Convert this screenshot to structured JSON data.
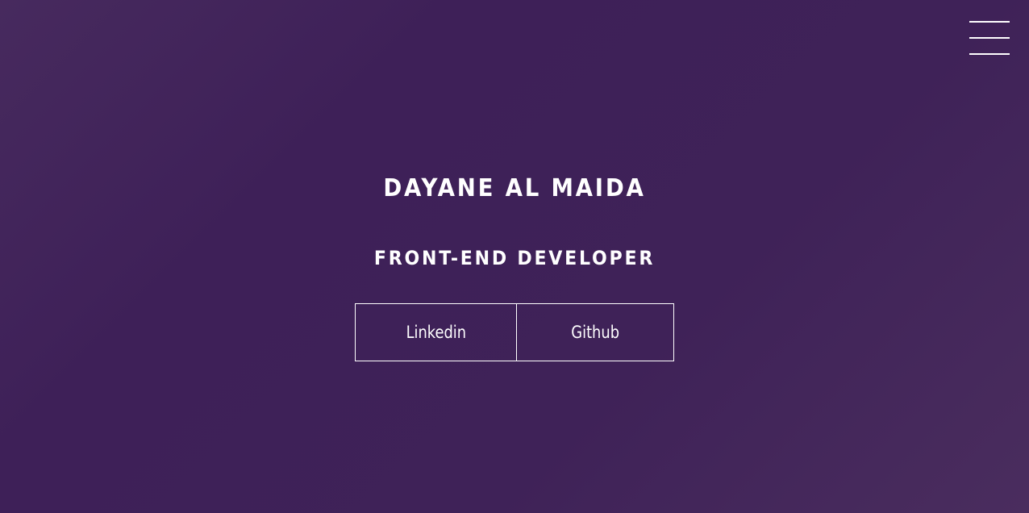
{
  "header": {
    "menu_icon": "hamburger-menu-icon"
  },
  "hero": {
    "name": "Dayane Al Maida",
    "title": "Front-End Developer"
  },
  "links": {
    "linkedin_label": "Linkedin",
    "github_label": "Github"
  },
  "colors": {
    "background_start": "#472a5e",
    "background_mid": "#3e2058",
    "text": "#ffffff",
    "border": "#ffffff"
  }
}
